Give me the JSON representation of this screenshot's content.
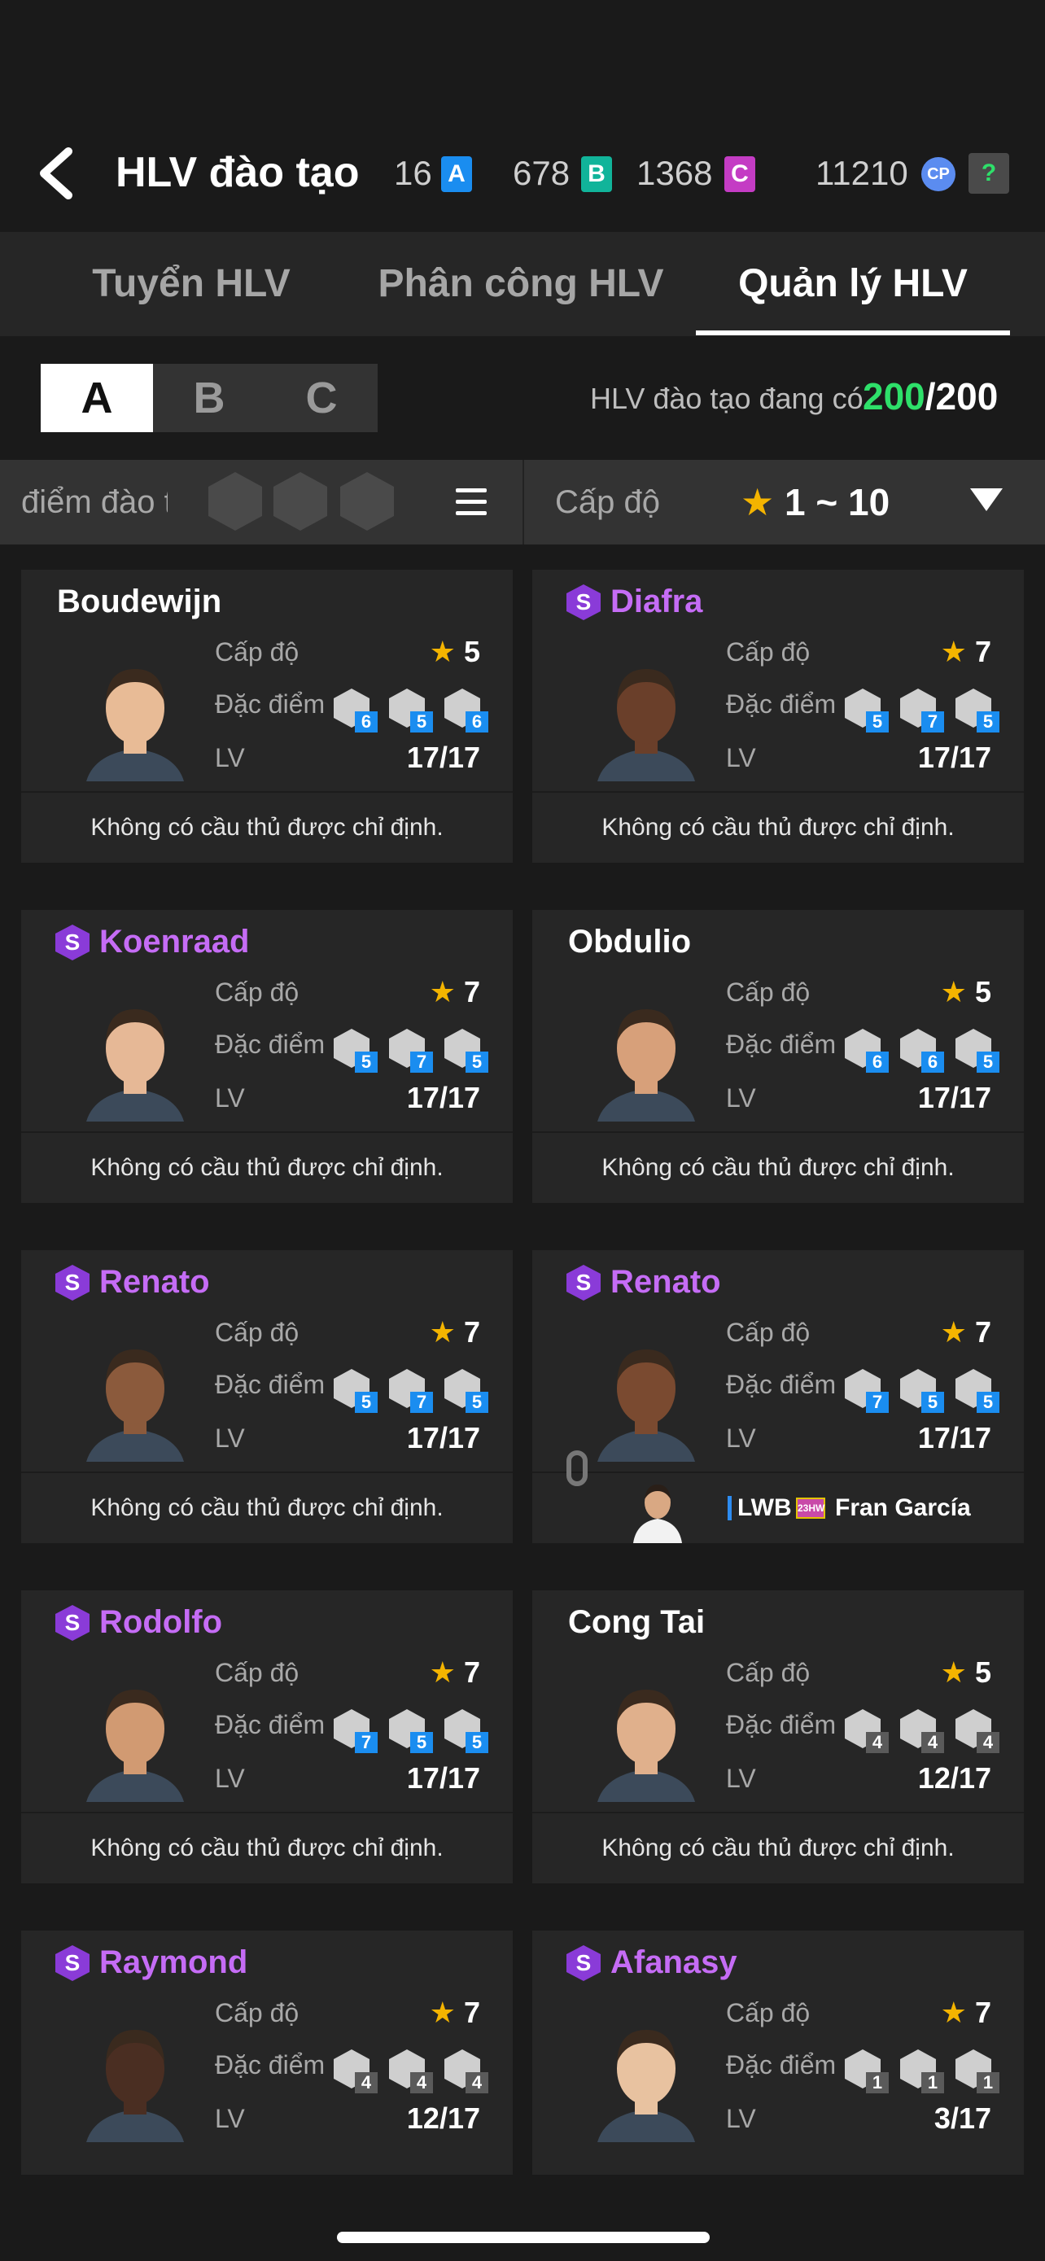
{
  "header": {
    "title": "HLV đào tạo",
    "currencies": [
      {
        "value": "16",
        "badge": "A",
        "color": "#1a8df0"
      },
      {
        "value": "678",
        "badge": "B",
        "color": "#11b49a"
      },
      {
        "value": "1368",
        "badge": "C",
        "color": "#c43cc4"
      },
      {
        "value": "11210",
        "badge": "CP",
        "color": "#5b8cf0"
      }
    ],
    "help_label": "?"
  },
  "tabs": [
    {
      "label": "Tuyển HLV"
    },
    {
      "label": "Phân công HLV"
    },
    {
      "label": "Quản lý HLV",
      "active": true
    }
  ],
  "segments": [
    "A",
    "B",
    "C"
  ],
  "coach_count": {
    "label": "HLV đào tạo đang có",
    "current": "200",
    "max": "/200"
  },
  "filters": {
    "points_label": "điểm đào tạ",
    "level_label": "Cấp độ",
    "level_star": "★",
    "level_range": "1 ~ 10"
  },
  "labels": {
    "level": "Cấp độ",
    "traits": "Đặc điểm",
    "lv": "LV",
    "star": "★"
  },
  "coaches": [
    {
      "name": "Boudewijn",
      "special": false,
      "stars": "5",
      "lv": "17/17",
      "traits": [
        "6",
        "5",
        "6"
      ],
      "trait_style": "blue",
      "footer": "Không có cầu thủ được chỉ định."
    },
    {
      "name": "Diafra",
      "special": true,
      "stars": "7",
      "lv": "17/17",
      "traits": [
        "5",
        "7",
        "5"
      ],
      "trait_style": "blue",
      "footer": "Không có cầu thủ được chỉ định."
    },
    {
      "name": "Koenraad",
      "special": true,
      "stars": "7",
      "lv": "17/17",
      "traits": [
        "5",
        "7",
        "5"
      ],
      "trait_style": "blue",
      "footer": "Không có cầu thủ được chỉ định."
    },
    {
      "name": "Obdulio",
      "special": false,
      "stars": "5",
      "lv": "17/17",
      "traits": [
        "6",
        "6",
        "5"
      ],
      "trait_style": "blue",
      "footer": "Không có cầu thủ được chỉ định."
    },
    {
      "name": "Renato",
      "special": true,
      "stars": "7",
      "lv": "17/17",
      "traits": [
        "5",
        "7",
        "5"
      ],
      "trait_style": "blue",
      "footer": "Không có cầu thủ được chỉ định."
    },
    {
      "name": "Renato",
      "special": true,
      "stars": "7",
      "lv": "17/17",
      "traits": [
        "7",
        "5",
        "5"
      ],
      "trait_style": "blue",
      "assigned": {
        "position": "LWB",
        "season": "23HW",
        "player": "Fran García"
      }
    },
    {
      "name": "Rodolfo",
      "special": true,
      "stars": "7",
      "lv": "17/17",
      "traits": [
        "7",
        "5",
        "5"
      ],
      "trait_style": "blue",
      "footer": "Không có cầu thủ được chỉ định."
    },
    {
      "name": "Cong Tai",
      "special": false,
      "stars": "5",
      "lv": "12/17",
      "traits": [
        "4",
        "4",
        "4"
      ],
      "trait_style": "gray",
      "footer": "Không có cầu thủ được chỉ định."
    },
    {
      "name": "Raymond",
      "special": true,
      "stars": "7",
      "lv": "12/17",
      "traits": [
        "4",
        "4",
        "4"
      ],
      "trait_style": "gray"
    },
    {
      "name": "Afanasy",
      "special": true,
      "stars": "7",
      "lv": "3/17",
      "traits": [
        "1",
        "1",
        "1"
      ],
      "trait_style": "gray"
    }
  ],
  "colors": {
    "special_name": "#c56cf5",
    "star": "#f4b400",
    "count_green": "#2ee06a",
    "trait_blue": "#1a8df0"
  }
}
